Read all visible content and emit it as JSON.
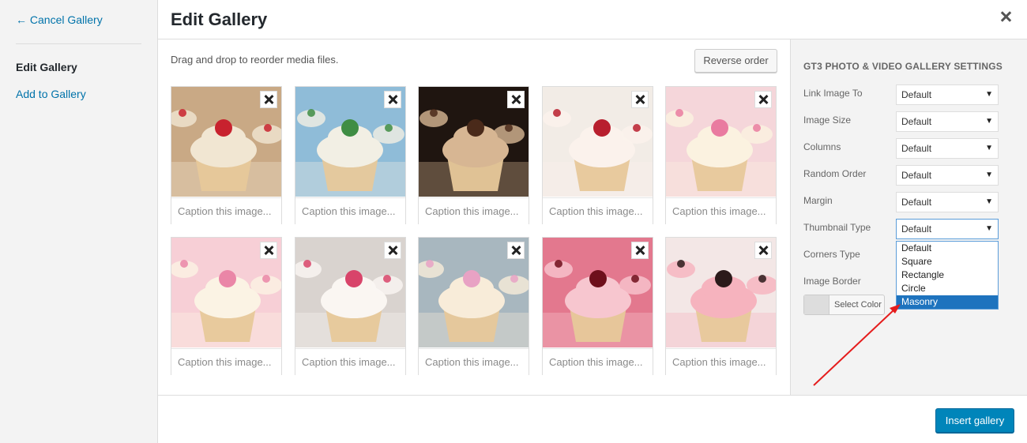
{
  "sidebar": {
    "cancel_label": "← Cancel Gallery",
    "items": [
      {
        "label": "Edit Gallery",
        "current": true
      },
      {
        "label": "Add to Gallery",
        "current": false
      }
    ]
  },
  "header": {
    "title": "Edit Gallery",
    "close_icon": "close-icon"
  },
  "main": {
    "instructions": "Drag and drop to reorder media files.",
    "reverse_label": "Reverse order",
    "caption_placeholder": "Caption this image...",
    "images": [
      {
        "subject": "cupcakes with raspberries",
        "colors": [
          "#c9a985",
          "#f1e6d2",
          "#c8222e"
        ]
      },
      {
        "subject": "cupcakes with green wrappers",
        "colors": [
          "#8fbcd8",
          "#f2efe4",
          "#3f8d43"
        ]
      },
      {
        "subject": "chocolate cupcakes",
        "colors": [
          "#1f1510",
          "#d7b693",
          "#4a2a1a"
        ]
      },
      {
        "subject": "red velvet cupcake",
        "colors": [
          "#f2ece6",
          "#fbf2ec",
          "#b81f2e"
        ]
      },
      {
        "subject": "pink flower cupcake",
        "colors": [
          "#f5d6da",
          "#fbf2e0",
          "#e97ba0"
        ]
      },
      {
        "subject": "pink sugar flower cupcake",
        "colors": [
          "#f7cfd6",
          "#fbf3e4",
          "#ea86a7"
        ]
      },
      {
        "subject": "heart topped cupcakes",
        "colors": [
          "#d9d3cf",
          "#faf6f2",
          "#d8446a"
        ]
      },
      {
        "subject": "pink rose cupcake",
        "colors": [
          "#a8b7bf",
          "#f8ecd9",
          "#e8a2c4"
        ]
      },
      {
        "subject": "cherry cupcake",
        "colors": [
          "#e3788e",
          "#f7c6cf",
          "#6e0f1b"
        ]
      },
      {
        "subject": "pink frosted cupcakes",
        "colors": [
          "#f3e7e6",
          "#f6b3be",
          "#2b1a1a"
        ]
      }
    ]
  },
  "settings": {
    "title": "GT3 PHOTO & VIDEO GALLERY SETTINGS",
    "rows": [
      {
        "label": "Link Image To",
        "value": "Default"
      },
      {
        "label": "Image Size",
        "value": "Default"
      },
      {
        "label": "Columns",
        "value": "Default"
      },
      {
        "label": "Random Order",
        "value": "Default"
      },
      {
        "label": "Margin",
        "value": "Default"
      },
      {
        "label": "Thumbnail Type",
        "value": "Default"
      },
      {
        "label": "Corners Type",
        "value": ""
      },
      {
        "label": "Image Border",
        "value": ""
      }
    ],
    "dropdown_options": [
      "Default",
      "Square",
      "Rectangle",
      "Circle",
      "Masonry"
    ],
    "highlighted_option": "Masonry",
    "select_color_label": "Select Color",
    "arrow_color": "#e51c1c"
  },
  "footer": {
    "insert_label": "Insert gallery",
    "accent": "#0085ba"
  }
}
